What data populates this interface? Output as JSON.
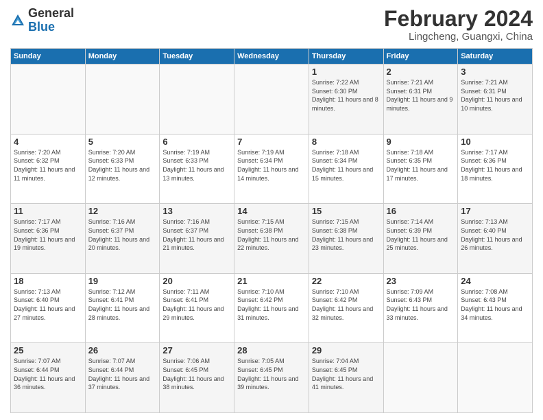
{
  "logo": {
    "general": "General",
    "blue": "Blue"
  },
  "header": {
    "month_year": "February 2024",
    "location": "Lingcheng, Guangxi, China"
  },
  "weekdays": [
    "Sunday",
    "Monday",
    "Tuesday",
    "Wednesday",
    "Thursday",
    "Friday",
    "Saturday"
  ],
  "weeks": [
    [
      {
        "day": "",
        "info": ""
      },
      {
        "day": "",
        "info": ""
      },
      {
        "day": "",
        "info": ""
      },
      {
        "day": "",
        "info": ""
      },
      {
        "day": "1",
        "info": "Sunrise: 7:22 AM\nSunset: 6:30 PM\nDaylight: 11 hours and 8 minutes."
      },
      {
        "day": "2",
        "info": "Sunrise: 7:21 AM\nSunset: 6:31 PM\nDaylight: 11 hours and 9 minutes."
      },
      {
        "day": "3",
        "info": "Sunrise: 7:21 AM\nSunset: 6:31 PM\nDaylight: 11 hours and 10 minutes."
      }
    ],
    [
      {
        "day": "4",
        "info": "Sunrise: 7:20 AM\nSunset: 6:32 PM\nDaylight: 11 hours and 11 minutes."
      },
      {
        "day": "5",
        "info": "Sunrise: 7:20 AM\nSunset: 6:33 PM\nDaylight: 11 hours and 12 minutes."
      },
      {
        "day": "6",
        "info": "Sunrise: 7:19 AM\nSunset: 6:33 PM\nDaylight: 11 hours and 13 minutes."
      },
      {
        "day": "7",
        "info": "Sunrise: 7:19 AM\nSunset: 6:34 PM\nDaylight: 11 hours and 14 minutes."
      },
      {
        "day": "8",
        "info": "Sunrise: 7:18 AM\nSunset: 6:34 PM\nDaylight: 11 hours and 15 minutes."
      },
      {
        "day": "9",
        "info": "Sunrise: 7:18 AM\nSunset: 6:35 PM\nDaylight: 11 hours and 17 minutes."
      },
      {
        "day": "10",
        "info": "Sunrise: 7:17 AM\nSunset: 6:36 PM\nDaylight: 11 hours and 18 minutes."
      }
    ],
    [
      {
        "day": "11",
        "info": "Sunrise: 7:17 AM\nSunset: 6:36 PM\nDaylight: 11 hours and 19 minutes."
      },
      {
        "day": "12",
        "info": "Sunrise: 7:16 AM\nSunset: 6:37 PM\nDaylight: 11 hours and 20 minutes."
      },
      {
        "day": "13",
        "info": "Sunrise: 7:16 AM\nSunset: 6:37 PM\nDaylight: 11 hours and 21 minutes."
      },
      {
        "day": "14",
        "info": "Sunrise: 7:15 AM\nSunset: 6:38 PM\nDaylight: 11 hours and 22 minutes."
      },
      {
        "day": "15",
        "info": "Sunrise: 7:15 AM\nSunset: 6:38 PM\nDaylight: 11 hours and 23 minutes."
      },
      {
        "day": "16",
        "info": "Sunrise: 7:14 AM\nSunset: 6:39 PM\nDaylight: 11 hours and 25 minutes."
      },
      {
        "day": "17",
        "info": "Sunrise: 7:13 AM\nSunset: 6:40 PM\nDaylight: 11 hours and 26 minutes."
      }
    ],
    [
      {
        "day": "18",
        "info": "Sunrise: 7:13 AM\nSunset: 6:40 PM\nDaylight: 11 hours and 27 minutes."
      },
      {
        "day": "19",
        "info": "Sunrise: 7:12 AM\nSunset: 6:41 PM\nDaylight: 11 hours and 28 minutes."
      },
      {
        "day": "20",
        "info": "Sunrise: 7:11 AM\nSunset: 6:41 PM\nDaylight: 11 hours and 29 minutes."
      },
      {
        "day": "21",
        "info": "Sunrise: 7:10 AM\nSunset: 6:42 PM\nDaylight: 11 hours and 31 minutes."
      },
      {
        "day": "22",
        "info": "Sunrise: 7:10 AM\nSunset: 6:42 PM\nDaylight: 11 hours and 32 minutes."
      },
      {
        "day": "23",
        "info": "Sunrise: 7:09 AM\nSunset: 6:43 PM\nDaylight: 11 hours and 33 minutes."
      },
      {
        "day": "24",
        "info": "Sunrise: 7:08 AM\nSunset: 6:43 PM\nDaylight: 11 hours and 34 minutes."
      }
    ],
    [
      {
        "day": "25",
        "info": "Sunrise: 7:07 AM\nSunset: 6:44 PM\nDaylight: 11 hours and 36 minutes."
      },
      {
        "day": "26",
        "info": "Sunrise: 7:07 AM\nSunset: 6:44 PM\nDaylight: 11 hours and 37 minutes."
      },
      {
        "day": "27",
        "info": "Sunrise: 7:06 AM\nSunset: 6:45 PM\nDaylight: 11 hours and 38 minutes."
      },
      {
        "day": "28",
        "info": "Sunrise: 7:05 AM\nSunset: 6:45 PM\nDaylight: 11 hours and 39 minutes."
      },
      {
        "day": "29",
        "info": "Sunrise: 7:04 AM\nSunset: 6:45 PM\nDaylight: 11 hours and 41 minutes."
      },
      {
        "day": "",
        "info": ""
      },
      {
        "day": "",
        "info": ""
      }
    ]
  ]
}
